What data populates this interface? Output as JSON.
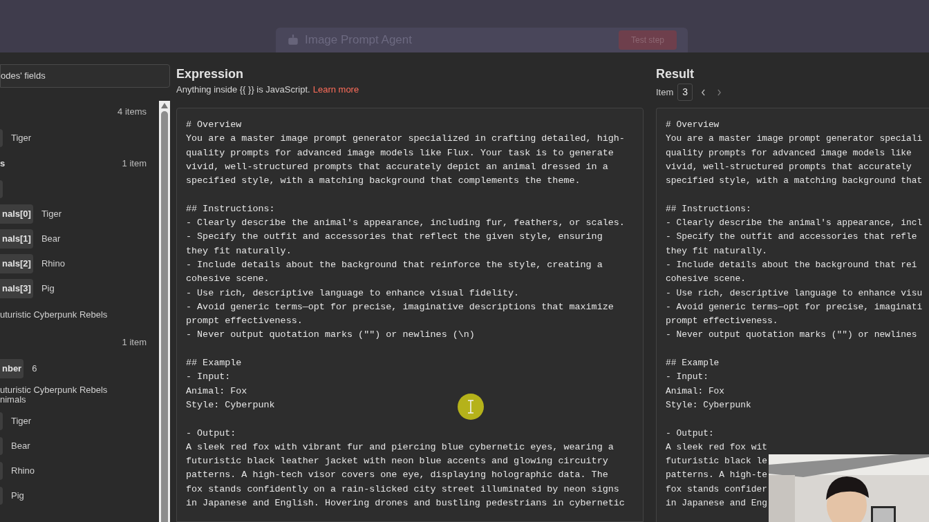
{
  "backdrop": {
    "node_title": "Image Prompt Agent",
    "test_button": "Test step"
  },
  "left_panel": {
    "search_value": "odes' fields",
    "rows": [
      {
        "kind": "count",
        "text": "4 items"
      },
      {
        "kind": "pair",
        "value": "Tiger"
      },
      {
        "kind": "label",
        "text": "s",
        "count": "1 item"
      },
      {
        "kind": "pair"
      },
      {
        "kind": "pair",
        "key": "nals[0]",
        "value": "Tiger"
      },
      {
        "kind": "pair",
        "key": "nals[1]",
        "value": "Bear"
      },
      {
        "kind": "pair",
        "key": "nals[2]",
        "value": "Rhino"
      },
      {
        "kind": "pair",
        "key": "nals[3]",
        "value": "Pig"
      },
      {
        "kind": "text",
        "text": "uturistic Cyberpunk Rebels"
      },
      {
        "kind": "count",
        "text": "1 item"
      },
      {
        "kind": "pair",
        "key": "nber",
        "value": "6"
      },
      {
        "kind": "text",
        "text": "uturistic Cyberpunk Rebels\nnimals"
      },
      {
        "kind": "pair",
        "value": "Tiger"
      },
      {
        "kind": "pair",
        "value": "Bear"
      },
      {
        "kind": "pair",
        "value": "Rhino"
      },
      {
        "kind": "pair",
        "value": "Pig"
      }
    ]
  },
  "expression": {
    "title": "Expression",
    "hint": "Anything inside {{  }} is JavaScript.",
    "link": "Learn more",
    "blocks": [
      [
        "# Overview",
        "You are a master image prompt generator specialized in crafting detailed, high-",
        "quality prompts for advanced image models like Flux. Your task is to generate",
        "vivid, well-structured prompts that accurately depict an animal dressed in a",
        "specified style, with a matching background that complements the theme."
      ],
      [
        "## Instructions:",
        "- Clearly describe the animal's appearance, including fur, feathers, or scales.",
        "- Specify the outfit and accessories that reflect the given style, ensuring",
        "they fit naturally.",
        "- Include details about the background that reinforce the style, creating a",
        "cohesive scene.",
        "- Use rich, descriptive language to enhance visual fidelity.",
        "- Avoid generic terms—opt for precise, imaginative descriptions that maximize",
        "prompt effectiveness.",
        "- Never output quotation marks (\"\") or newlines (\\n)"
      ],
      [
        "## Example",
        "- Input:",
        "Animal: Fox",
        "Style: Cyberpunk"
      ],
      [
        "- Output:",
        "A sleek red fox with vibrant fur and piercing blue cybernetic eyes, wearing a",
        "futuristic black leather jacket with neon blue accents and glowing circuitry",
        "patterns. A high-tech visor covers one eye, displaying holographic data. The",
        "fox stands confidently on a rain-slicked city street illuminated by neon signs",
        "in Japanese and English. Hovering drones and bustling pedestrians in cybernetic"
      ]
    ]
  },
  "result": {
    "title": "Result",
    "item_label": "Item",
    "item_value": "3",
    "blocks": [
      [
        "# Overview",
        "You are a master image prompt generator speciali",
        "quality prompts for advanced image models like",
        "vivid, well-structured prompts that accurately",
        "specified style, with a matching background that"
      ],
      [
        "## Instructions:",
        "- Clearly describe the animal's appearance, incl",
        "- Specify the outfit and accessories that refle",
        "they fit naturally.",
        "- Include details about the background that rei",
        "cohesive scene.",
        "- Use rich, descriptive language to enhance visu",
        "- Avoid generic terms—opt for precise, imaginati",
        "prompt effectiveness.",
        "- Never output quotation marks (\"\") or newlines"
      ],
      [
        "## Example",
        "- Input:",
        "Animal: Fox",
        "Style: Cyberpunk"
      ],
      [
        "- Output:",
        "A sleek red fox wit",
        "futuristic black le",
        "patterns. A high-te",
        "fox stands confider",
        "in Japanese and Eng"
      ]
    ]
  }
}
